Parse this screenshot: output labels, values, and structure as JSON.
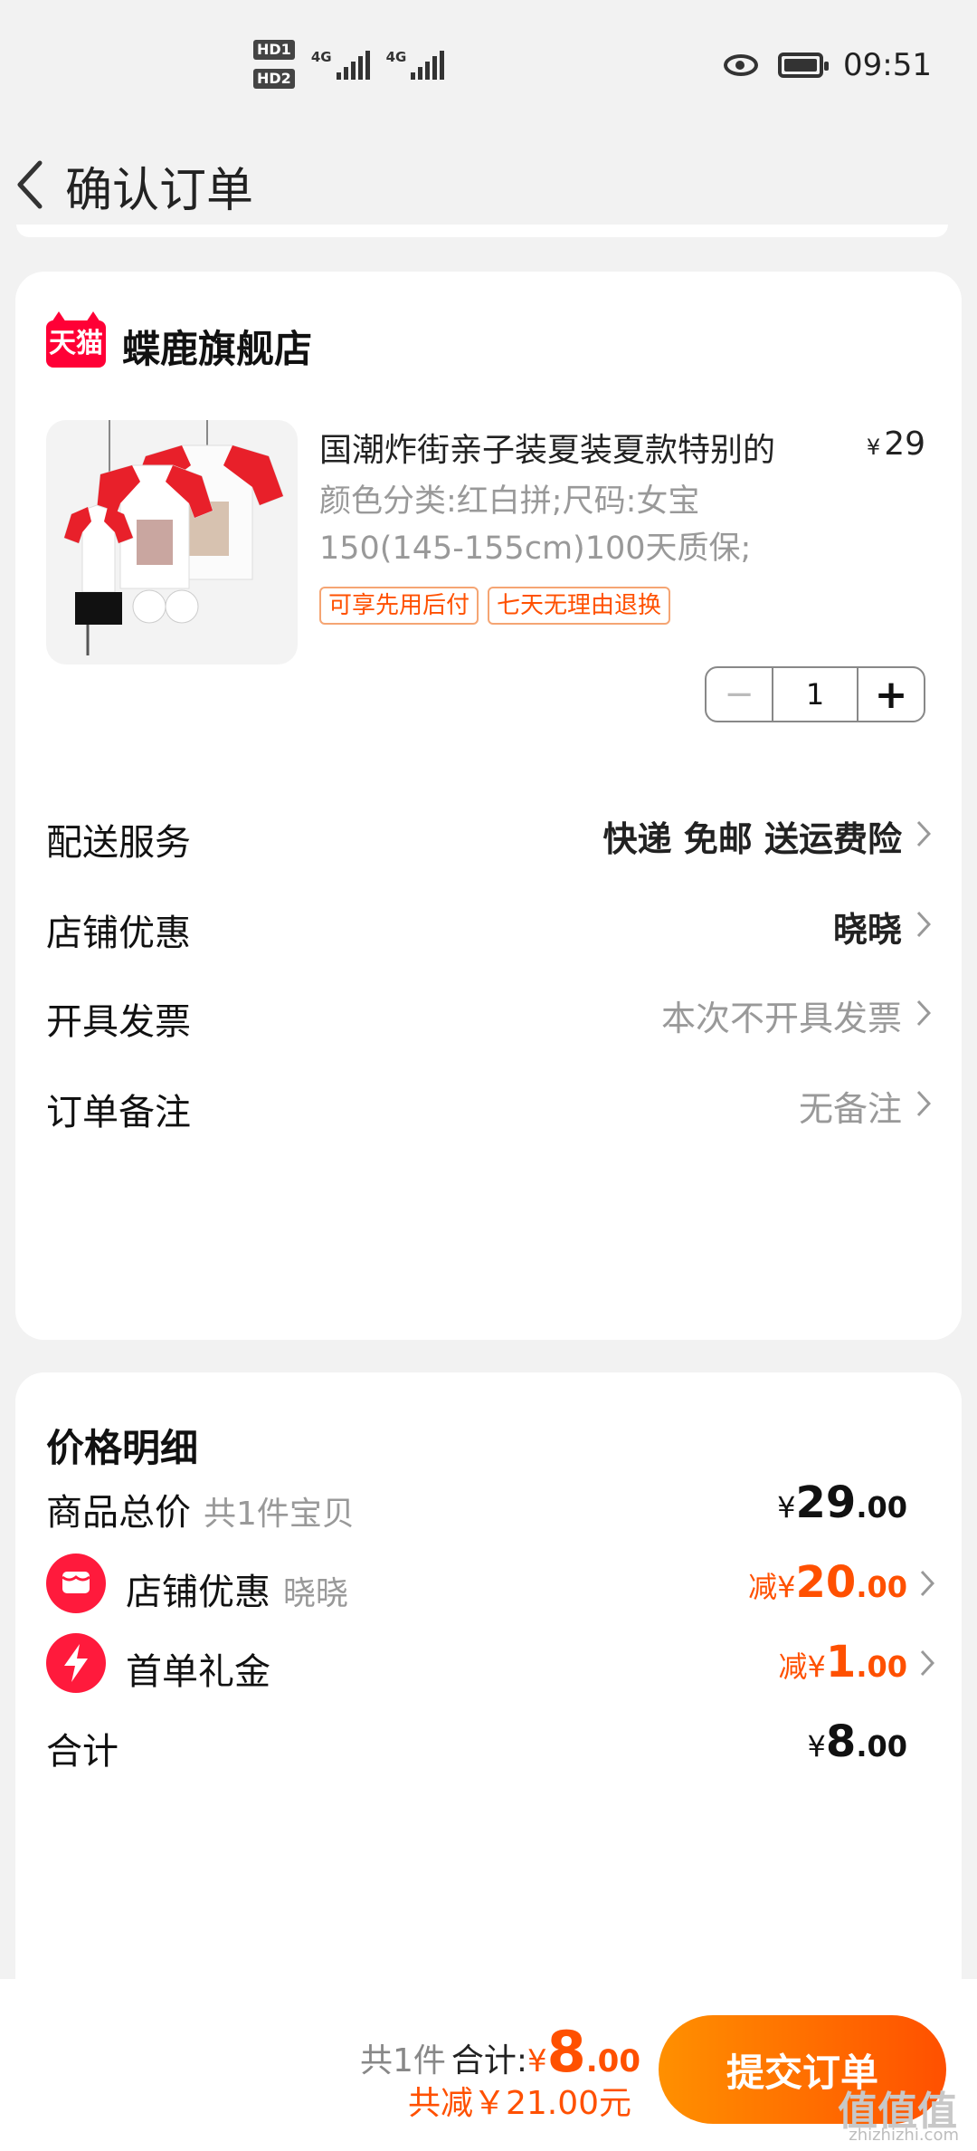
{
  "status_bar": {
    "sim1": "HD1",
    "sim2": "HD2",
    "net1": "4G",
    "net2": "4G",
    "time": "09:51"
  },
  "nav": {
    "title": "确认订单"
  },
  "shop": {
    "logo_text": "天猫",
    "name": "蝶鹿旗舰店"
  },
  "product": {
    "title": "国潮炸街亲子装夏装夏款特别的",
    "price_symbol": "¥",
    "price": "29",
    "sku": "颜色分类:红白拼;尺码:女宝150(145-155cm)100天质保;",
    "tags": [
      "可享先用后付",
      "七天无理由退换"
    ],
    "quantity": "1",
    "minus": "−",
    "plus": "+"
  },
  "rows": [
    {
      "label": "配送服务",
      "value": "快递 免邮 送运费险"
    },
    {
      "label": "店铺优惠",
      "value": "晓晓"
    },
    {
      "label": "开具发票",
      "value": "本次不开具发票"
    },
    {
      "label": "订单备注",
      "value": "无备注"
    }
  ],
  "price_detail": {
    "title": "价格明细",
    "goods_total": {
      "label": "商品总价",
      "sub": "共1件宝贝",
      "yen": "¥",
      "int": "29",
      "dec": ".00"
    },
    "shop_discount": {
      "label": "店铺优惠",
      "sub": "晓晓",
      "prefix": "减",
      "yen": "¥",
      "int": "20",
      "dec": ".00",
      "icon": "shop-coupon-icon"
    },
    "first_gift": {
      "label": "首单礼金",
      "prefix": "减",
      "yen": "¥",
      "int": "1",
      "dec": ".00",
      "icon": "lightning-icon"
    },
    "total": {
      "label": "合计",
      "yen": "¥",
      "int": "8",
      "dec": ".00"
    }
  },
  "bottom": {
    "count": "共1件",
    "total_label": "合计:",
    "yen": "¥",
    "int": "8",
    "dec": ".00",
    "saved": "共减￥21.00元",
    "submit": "提交订单",
    "watermark": "值值值",
    "watermark_url": "zhizhizhi.com"
  },
  "colors": {
    "accent": "#ff5000",
    "tmall": "#ff0036",
    "icon_red": "#ff1a3c"
  }
}
